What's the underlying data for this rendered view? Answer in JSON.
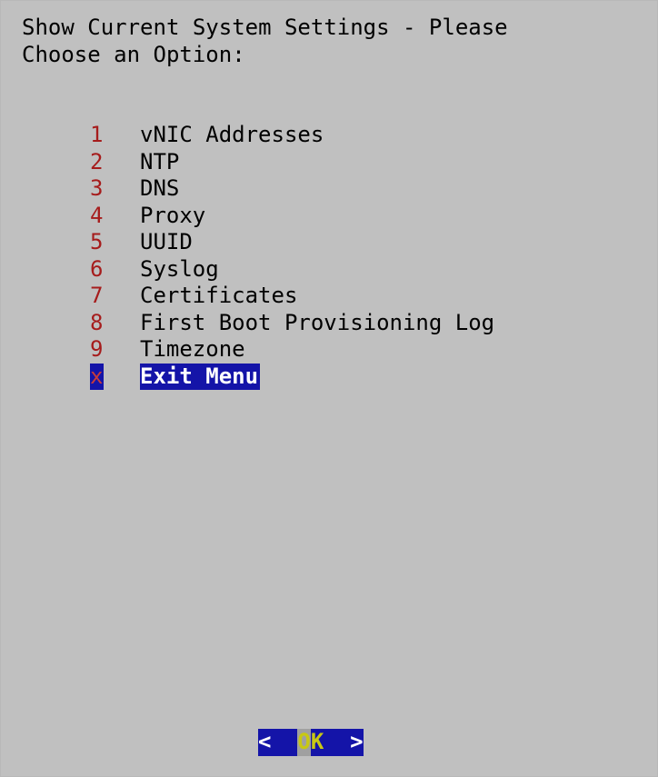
{
  "dialog": {
    "title_line1": "Show Current System Settings - Please",
    "title_line2": "Choose an Option:"
  },
  "menu": {
    "items": [
      {
        "key": "1",
        "label": "vNIC Addresses"
      },
      {
        "key": "2",
        "label": "NTP"
      },
      {
        "key": "3",
        "label": "DNS"
      },
      {
        "key": "4",
        "label": "Proxy"
      },
      {
        "key": "5",
        "label": "UUID"
      },
      {
        "key": "6",
        "label": "Syslog"
      },
      {
        "key": "7",
        "label": "Certificates"
      },
      {
        "key": "8",
        "label": "First Boot Provisioning Log"
      },
      {
        "key": "9",
        "label": "Timezone"
      },
      {
        "key": "x",
        "label": "Exit Menu",
        "selected": true
      }
    ]
  },
  "buttons": {
    "ok": {
      "left_bracket": "<  ",
      "hotkey": "O",
      "rest": "K",
      "right_bracket": "  >"
    }
  },
  "colors": {
    "background": "#c0c0c0",
    "menu_key": "#a61c1c",
    "selection_bg": "#1414a8",
    "selection_fg": "#ffffff",
    "button_label": "#c8c814"
  }
}
